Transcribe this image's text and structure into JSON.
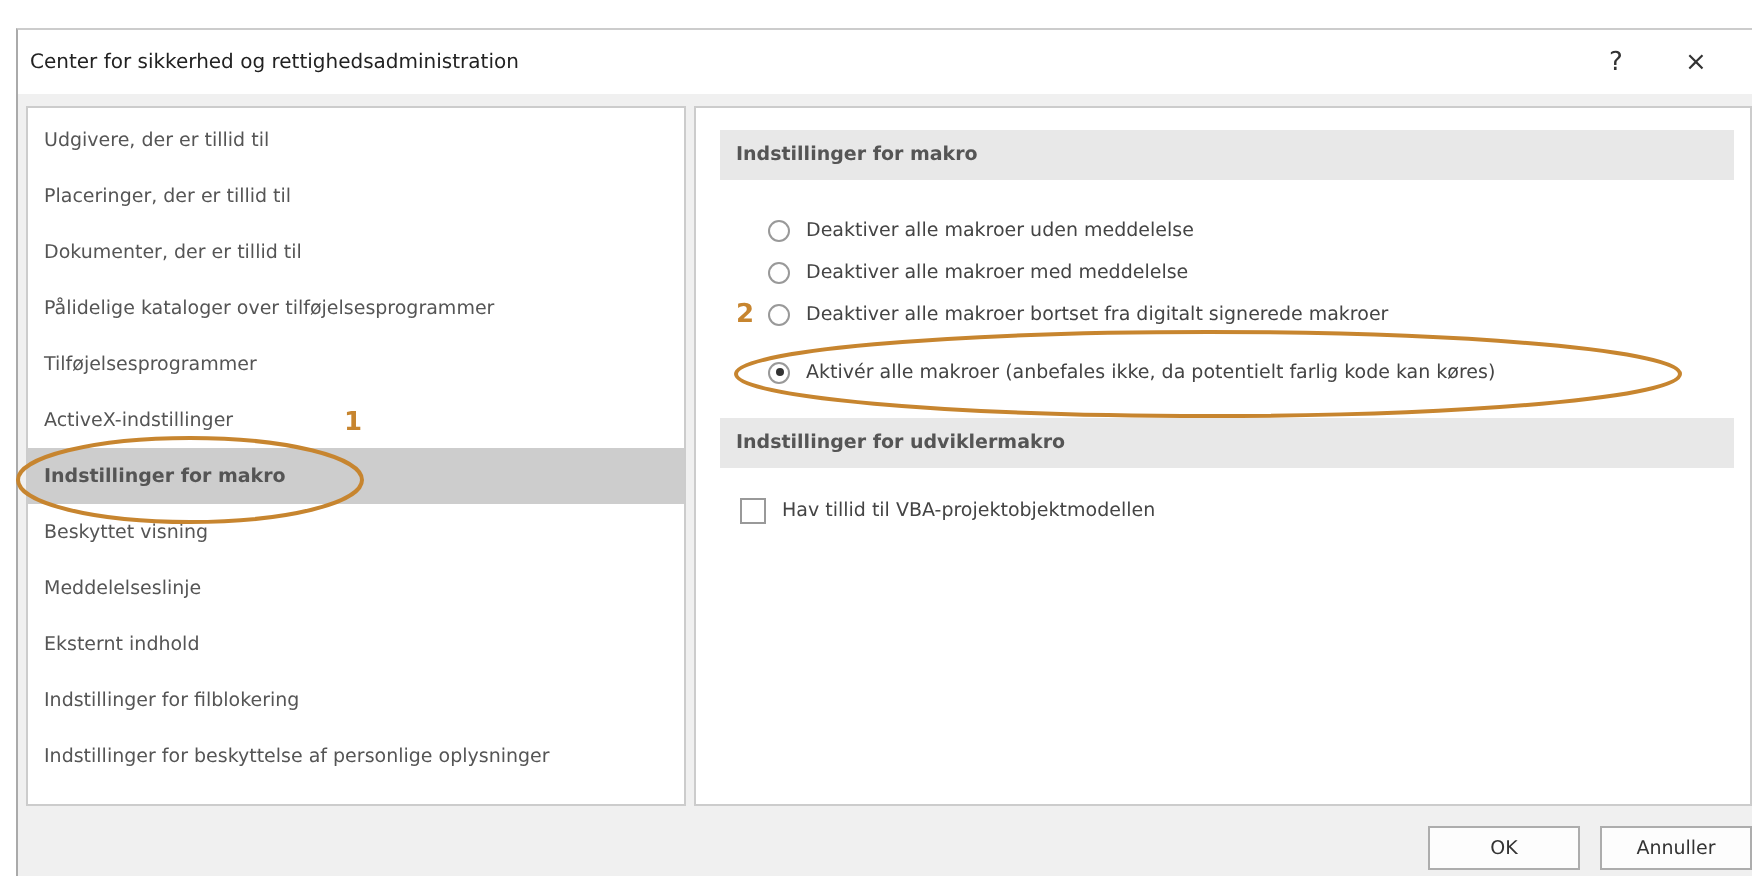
{
  "window": {
    "title": "Center for sikkerhed og rettighedsadministration",
    "help": "?",
    "close": "×"
  },
  "sidebar": {
    "items": [
      {
        "label": "Udgivere, der er tillid til",
        "selected": false
      },
      {
        "label": "Placeringer, der er tillid til",
        "selected": false
      },
      {
        "label": "Dokumenter, der er tillid til",
        "selected": false
      },
      {
        "label": "Pålidelige kataloger over tilføjelsesprogrammer",
        "selected": false
      },
      {
        "label": "Tilføjelsesprogrammer",
        "selected": false
      },
      {
        "label": "ActiveX-indstillinger",
        "selected": false
      },
      {
        "label": "Indstillinger for makro",
        "selected": true
      },
      {
        "label": "Beskyttet visning",
        "selected": false
      },
      {
        "label": "Meddelelseslinje",
        "selected": false
      },
      {
        "label": "Eksternt indhold",
        "selected": false
      },
      {
        "label": "Indstillinger for filblokering",
        "selected": false
      },
      {
        "label": "Indstillinger for beskyttelse af personlige oplysninger",
        "selected": false
      }
    ]
  },
  "sections": [
    {
      "title": "Indstillinger for makro",
      "items": [
        {
          "kind": "radio",
          "label": "Deaktiver alle makroer uden meddelelse",
          "selected": false
        },
        {
          "kind": "radio",
          "label": "Deaktiver alle makroer med meddelelse",
          "selected": false
        },
        {
          "kind": "radio",
          "label": "Deaktiver alle makroer bortset fra digitalt signerede makroer",
          "selected": false
        },
        {
          "kind": "radio",
          "label": "Aktivér alle makroer (anbefales ikke, da potentielt farlig kode kan køres)",
          "selected": true
        }
      ]
    },
    {
      "title": "Indstillinger for udviklermakro",
      "items": [
        {
          "kind": "checkbox",
          "label": "Hav tillid til VBA-projektobjektmodellen",
          "checked": false
        }
      ]
    }
  ],
  "annotations": [
    {
      "number": "1"
    },
    {
      "number": "2"
    }
  ],
  "buttons": [
    "OK",
    "Annuller"
  ]
}
